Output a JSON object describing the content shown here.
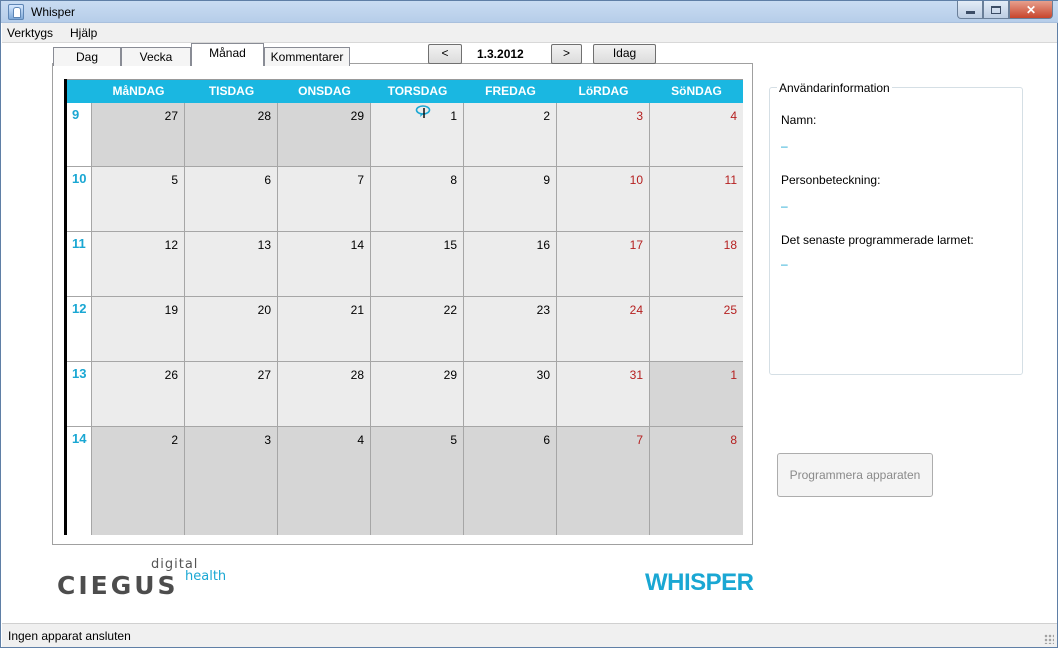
{
  "window": {
    "title": "Whisper"
  },
  "menu": {
    "items": [
      "Verktygs",
      "Hjälp"
    ]
  },
  "tabs": [
    {
      "label": "Dag",
      "active": false
    },
    {
      "label": "Vecka",
      "active": false
    },
    {
      "label": "Månad",
      "active": true
    },
    {
      "label": "Kommentarer",
      "active": false
    }
  ],
  "nav": {
    "prev": "<",
    "date": "1.3.2012",
    "next": ">",
    "today": "Idag"
  },
  "calendar": {
    "day_names": [
      "MåNDAG",
      "TISDAG",
      "ONSDAG",
      "TORSDAG",
      "FREDAG",
      "LöRDAG",
      "SöNDAG"
    ],
    "weeks": [
      {
        "week": "9",
        "days": [
          {
            "n": "27",
            "other": true
          },
          {
            "n": "28",
            "other": true
          },
          {
            "n": "29",
            "other": true
          },
          {
            "n": "1",
            "alarm": true
          },
          {
            "n": "2"
          },
          {
            "n": "3",
            "red": true
          },
          {
            "n": "4",
            "red": true
          }
        ]
      },
      {
        "week": "10",
        "days": [
          {
            "n": "5"
          },
          {
            "n": "6"
          },
          {
            "n": "7"
          },
          {
            "n": "8"
          },
          {
            "n": "9"
          },
          {
            "n": "10",
            "red": true
          },
          {
            "n": "11",
            "red": true
          }
        ]
      },
      {
        "week": "11",
        "days": [
          {
            "n": "12"
          },
          {
            "n": "13"
          },
          {
            "n": "14"
          },
          {
            "n": "15"
          },
          {
            "n": "16"
          },
          {
            "n": "17",
            "red": true
          },
          {
            "n": "18",
            "red": true
          }
        ]
      },
      {
        "week": "12",
        "days": [
          {
            "n": "19"
          },
          {
            "n": "20"
          },
          {
            "n": "21"
          },
          {
            "n": "22"
          },
          {
            "n": "23"
          },
          {
            "n": "24",
            "red": true
          },
          {
            "n": "25",
            "red": true
          }
        ]
      },
      {
        "week": "13",
        "days": [
          {
            "n": "26"
          },
          {
            "n": "27"
          },
          {
            "n": "28"
          },
          {
            "n": "29"
          },
          {
            "n": "30"
          },
          {
            "n": "31",
            "red": true
          },
          {
            "n": "1",
            "red": true,
            "other": true
          }
        ]
      },
      {
        "week": "14",
        "days": [
          {
            "n": "2",
            "other": true
          },
          {
            "n": "3",
            "other": true
          },
          {
            "n": "4",
            "other": true
          },
          {
            "n": "5",
            "other": true
          },
          {
            "n": "6",
            "other": true
          },
          {
            "n": "7",
            "red": true,
            "other": true
          },
          {
            "n": "8",
            "red": true,
            "other": true
          }
        ]
      }
    ],
    "colors": {
      "header": "#1ab7e1",
      "week_number": "#1aa7d3",
      "weekend": "#b52020"
    }
  },
  "user_info": {
    "legend": "Användarinformation",
    "name_label": "Namn:",
    "name_value": "–",
    "id_label": "Personbeteckning:",
    "id_value": "–",
    "alarm_label": "Det senaste programmerade larmet:",
    "alarm_value": "–"
  },
  "program_button": "Programmera apparaten",
  "logos": {
    "ciegus": "CIEGUS",
    "ciegus_top": "digital",
    "ciegus_sub": "health",
    "whisper": "WHISPER"
  },
  "status": {
    "text": "Ingen apparat ansluten"
  }
}
